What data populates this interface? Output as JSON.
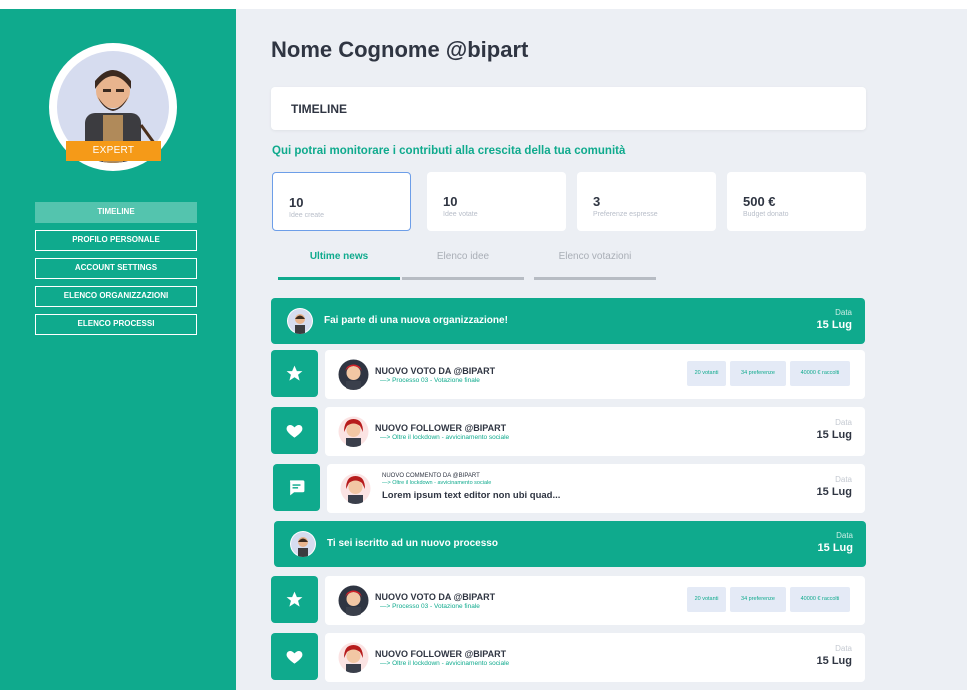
{
  "profile": {
    "badge": "EXPERT"
  },
  "sidebar": {
    "items": [
      {
        "label": "TIMELINE"
      },
      {
        "label": "PROFILO PERSONALE"
      },
      {
        "label": "ACCOUNT SETTINGS"
      },
      {
        "label": "ELENCO ORGANIZZAZIONI"
      },
      {
        "label": "ELENCO PROCESSI"
      }
    ]
  },
  "header": {
    "title": "Nome Cognome @bipart"
  },
  "timeline_card": {
    "label": "TIMELINE"
  },
  "subtitle": "Qui potrai monitorare i contributi alla crescita della tua comunità",
  "stats": [
    {
      "value": "10",
      "label": "Idee create"
    },
    {
      "value": "10",
      "label": "Idee votate"
    },
    {
      "value": "3",
      "label": "Preferenze espresse"
    },
    {
      "value": "500 €",
      "label": "Budget donato"
    }
  ],
  "tabs": [
    {
      "label": "Ultime news"
    },
    {
      "label": "Elenco idee"
    },
    {
      "label": "Elenco votazioni"
    }
  ],
  "feed": {
    "banner1": {
      "text": "Fai parte di una nuova organizzazione!",
      "date_label": "Data",
      "date": "15 Lug"
    },
    "vote1": {
      "title": "NUOVO VOTO DA @BIPART",
      "sub": "—> Processo 03 - Votazione finale",
      "chips": [
        "20 votanti",
        "34 preferenze",
        "40000 € raccolti"
      ]
    },
    "follow1": {
      "title": "NUOVO FOLLOWER @BIPART",
      "sub": "—> Oltre il lockdown - avvicinamento sociale",
      "date_label": "Data",
      "date": "15 Lug"
    },
    "comment1": {
      "title": "NUOVO COMMENTO DA @BIPART",
      "sub": "—> Oltre il lockdown - avvicinamento sociale",
      "body": "Lorem ipsum text editor non ubi quad...",
      "date_label": "Data",
      "date": "15 Lug"
    },
    "banner2": {
      "text": "Ti sei iscritto ad un nuovo processo",
      "date_label": "Data",
      "date": "15 Lug"
    },
    "vote2": {
      "title": "NUOVO VOTO DA @BIPART",
      "sub": "—> Processo 03 - Votazione finale",
      "chips": [
        "20 votanti",
        "34 preferenze",
        "40000 € raccolti"
      ]
    },
    "follow2": {
      "title": "NUOVO FOLLOWER @BIPART",
      "sub": "—> Oltre il lockdown - avvicinamento sociale",
      "date_label": "Data",
      "date": "15 Lug"
    }
  },
  "colors": {
    "primary": "#0faa8d",
    "badge": "#f59a18",
    "background": "#eceff4"
  },
  "icons": [
    "star-icon",
    "heart-icon",
    "comment-icon",
    "avatar-icon"
  ]
}
